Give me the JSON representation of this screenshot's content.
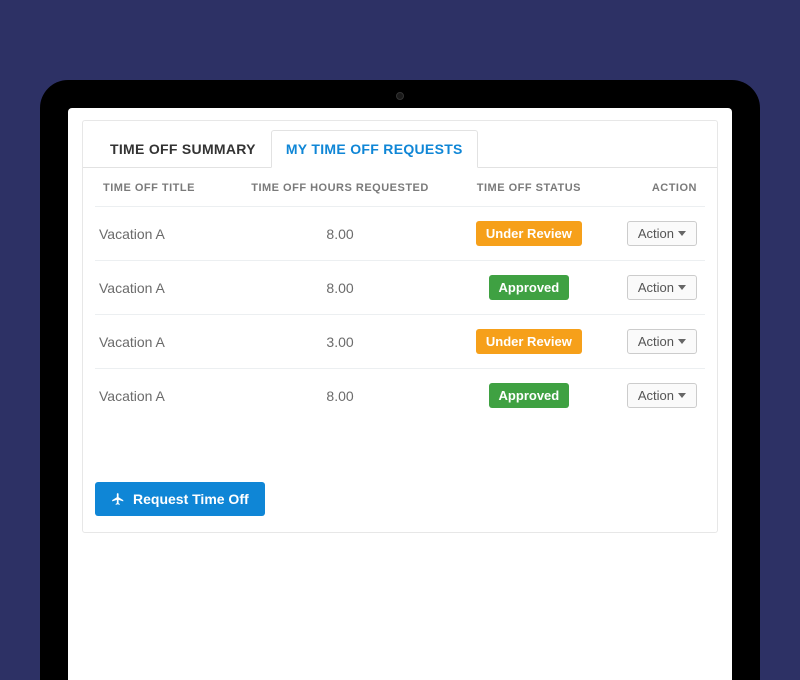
{
  "tabs": {
    "summary": "TIME OFF SUMMARY",
    "requests": "MY TIME OFF REQUESTS"
  },
  "columns": {
    "title": "TIME OFF TITLE",
    "hours": "TIME OFF HOURS REQUESTED",
    "status": "TIME OFF STATUS",
    "action": "ACTION"
  },
  "status_labels": {
    "review": "Under Review",
    "approved": "Approved"
  },
  "action_label": "Action",
  "rows": [
    {
      "title": "Vacation A",
      "hours": "8.00",
      "status": "review"
    },
    {
      "title": "Vacation A",
      "hours": "8.00",
      "status": "approved"
    },
    {
      "title": "Vacation A",
      "hours": "3.00",
      "status": "review"
    },
    {
      "title": "Vacation A",
      "hours": "8.00",
      "status": "approved"
    }
  ],
  "request_button": "Request Time Off",
  "colors": {
    "page_bg": "#2d3165",
    "accent": "#0f86d6",
    "review": "#f6a01a",
    "approved": "#3fa142"
  }
}
